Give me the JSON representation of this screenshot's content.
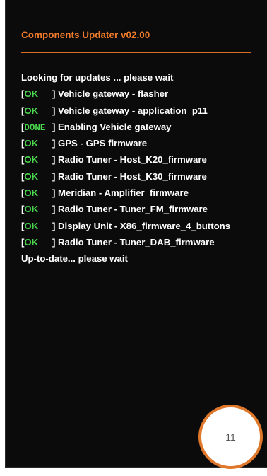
{
  "header": {
    "title": "Components Updater v02.00",
    "accent_color": "#f07a2a"
  },
  "log": {
    "intro": "Looking for updates ... please wait",
    "entries": [
      {
        "status": "OK",
        "message": "Vehicle gateway - flasher"
      },
      {
        "status": "OK",
        "message": "Vehicle gateway - application_p11"
      },
      {
        "status": "DONE",
        "message": "Enabling Vehicle gateway"
      },
      {
        "status": "OK",
        "message": "GPS - GPS firmware"
      },
      {
        "status": "OK",
        "message": "Radio Tuner - Host_K20_firmware"
      },
      {
        "status": "OK",
        "message": "Radio Tuner - Host_K30_firmware"
      },
      {
        "status": "OK",
        "message": "Meridian - Amplifier_firmware"
      },
      {
        "status": "OK",
        "message": "Radio Tuner - Tuner_FM_firmware"
      },
      {
        "status": "OK",
        "message": "Display Unit - X86_firmware_4_buttons"
      },
      {
        "status": "OK",
        "message": "Radio Tuner - Tuner_DAB_firmware"
      }
    ],
    "footer": "Up-to-date... please wait",
    "status_color": "#49d64d"
  },
  "step_badge": {
    "number": "11",
    "border_color": "#e0782c"
  }
}
